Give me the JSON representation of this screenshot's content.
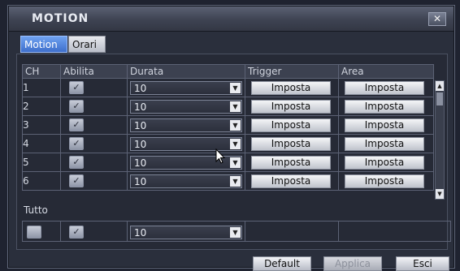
{
  "dialog": {
    "title": "MOTION",
    "close_label": "✕"
  },
  "tabs": [
    {
      "label": "Motion",
      "active": true
    },
    {
      "label": "Orari",
      "active": false
    }
  ],
  "table": {
    "headers": [
      "CH",
      "Abilita",
      "Durata",
      "Trigger",
      "Area"
    ],
    "rows": [
      {
        "ch": "1",
        "abilita": true,
        "durata": "10",
        "trigger": "Imposta",
        "area": "Imposta"
      },
      {
        "ch": "2",
        "abilita": true,
        "durata": "10",
        "trigger": "Imposta",
        "area": "Imposta"
      },
      {
        "ch": "3",
        "abilita": true,
        "durata": "10",
        "trigger": "Imposta",
        "area": "Imposta"
      },
      {
        "ch": "4",
        "abilita": true,
        "durata": "10",
        "trigger": "Imposta",
        "area": "Imposta"
      },
      {
        "ch": "5",
        "abilita": true,
        "durata": "10",
        "trigger": "Imposta",
        "area": "Imposta"
      },
      {
        "ch": "6",
        "abilita": true,
        "durata": "10",
        "trigger": "Imposta",
        "area": "Imposta"
      }
    ]
  },
  "tutto": {
    "label": "Tutto",
    "first_checked": false,
    "abilita_checked": true,
    "durata": "10"
  },
  "footer": {
    "default_label": "Default",
    "applica_label": "Applica",
    "esci_label": "Esci"
  },
  "icons": {
    "check": "✓",
    "dropdown": "▼",
    "scroll_up": "▲",
    "scroll_down": "▼"
  }
}
